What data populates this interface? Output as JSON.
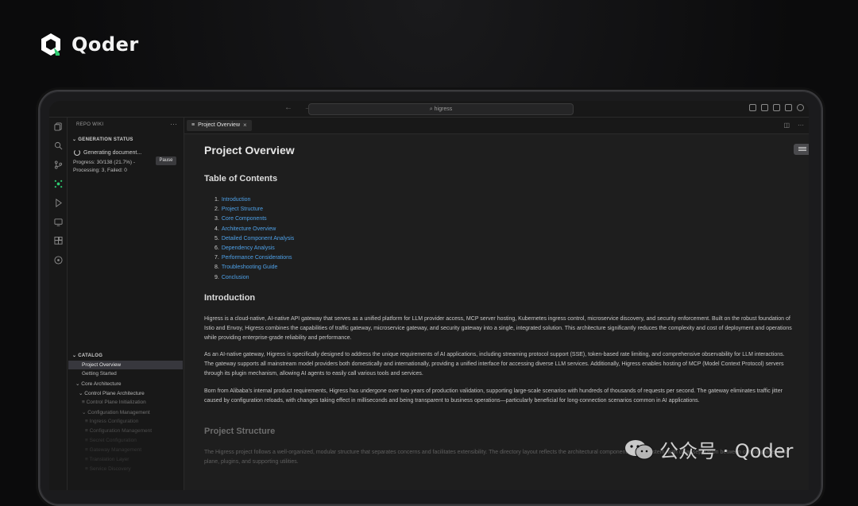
{
  "brand": {
    "name": "Qoder"
  },
  "titlebar": {
    "search": "higress",
    "nav": "← →"
  },
  "activity_icons": [
    "files-icon",
    "search-icon",
    "source-control-icon",
    "repo-wiki-icon",
    "run-debug-icon",
    "remote-icon",
    "extensions-icon",
    "compass-icon"
  ],
  "sidebar": {
    "title": "REPO WIKI",
    "more": "···",
    "generation": {
      "heading": "GENERATION STATUS",
      "status": "Generating document...",
      "progress": "Progress: 30/138 (21.7%) -",
      "processing": "Processing: 3, Failed: 0",
      "pause_label": "Pause"
    },
    "catalog": {
      "heading": "CATALOG",
      "items": [
        {
          "label": "Project Overview",
          "active": true
        },
        {
          "label": "Getting Started"
        },
        {
          "label": "Core Architecture"
        },
        {
          "label": "Control Plane Architecture"
        },
        {
          "label": "Control Plane Initialization"
        },
        {
          "label": "Configuration Management"
        },
        {
          "label": "Ingress Configuration"
        },
        {
          "label": "Configuration Management"
        },
        {
          "label": "Secret Configuration"
        },
        {
          "label": "Gateway Management"
        },
        {
          "label": "Translation Layer"
        },
        {
          "label": "Service Discovery"
        }
      ]
    }
  },
  "tab": {
    "label": "Project Overview",
    "close": "×"
  },
  "doc": {
    "title": "Project Overview",
    "toc_heading": "Table of Contents",
    "toc": [
      "Introduction",
      "Project Structure",
      "Core Components",
      "Architecture Overview",
      "Detailed Component Analysis",
      "Dependency Analysis",
      "Performance Considerations",
      "Troubleshooting Guide",
      "Conclusion"
    ],
    "intro_heading": "Introduction",
    "intro_p1": "Higress is a cloud-native, AI-native API gateway that serves as a unified platform for LLM provider access, MCP server hosting, Kubernetes ingress control, microservice discovery, and security enforcement. Built on the robust foundation of Istio and Envoy, Higress combines the capabilities of traffic gateway, microservice gateway, and security gateway into a single, integrated solution. This architecture significantly reduces the complexity and cost of deployment and operations while providing enterprise-grade reliability and performance.",
    "intro_p2": "As an AI-native gateway, Higress is specifically designed to address the unique requirements of AI applications, including streaming protocol support (SSE), token-based rate limiting, and comprehensive observability for LLM interactions. The gateway supports all mainstream model providers both domestically and internationally, providing a unified interface for accessing diverse LLM services. Additionally, Higress enables hosting of MCP (Model Context Protocol) servers through its plugin mechanism, allowing AI agents to easily call various tools and services.",
    "intro_p3": "Born from Alibaba's internal product requirements, Higress has undergone over two years of production validation, supporting large-scale scenarios with hundreds of thousands of requests per second. The gateway eliminates traffic jitter caused by configuration reloads, with changes taking effect in milliseconds and being transparent to business operations—particularly beneficial for long-connection scenarios common in AI applications.",
    "structure_heading": "Project Structure",
    "structure_p1": "The Higress project follows a well-organized, modular structure that separates concerns and facilitates extensibility. The directory layout reflects the architectural components of the system, with clear separation between control plane, data plane, plugins, and supporting utilities."
  },
  "watermark": {
    "text": "公众号 · Qoder"
  },
  "colors": {
    "link": "#4ea1e8",
    "accent_green": "#2ecc71",
    "background": "#0b0b0c",
    "editor": "#1e1e1e"
  }
}
